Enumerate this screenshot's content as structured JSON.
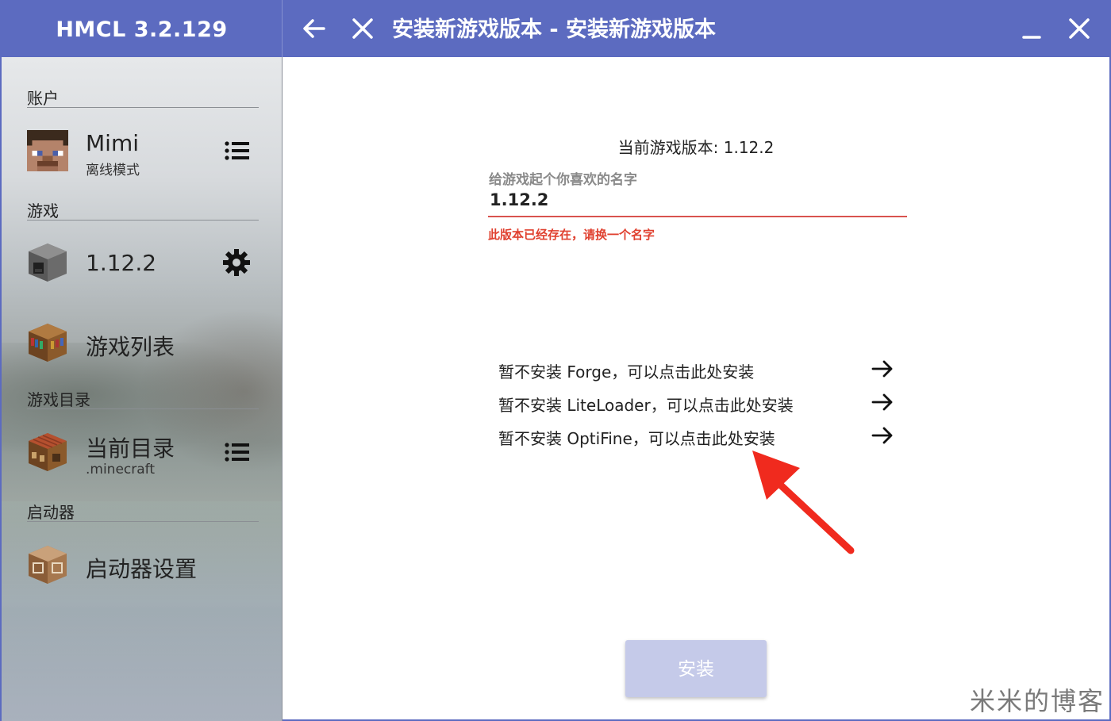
{
  "app": {
    "title": "HMCL 3.2.129"
  },
  "header": {
    "page_title": "安装新游戏版本 - 安装新游戏版本",
    "back_icon": "arrow-left-icon",
    "close_page_icon": "close-icon",
    "minimize_icon": "minimize-icon",
    "close_window_icon": "close-icon",
    "accent": "#5c6bc0"
  },
  "sidebar": {
    "sections": {
      "account": "账户",
      "game": "游戏",
      "game_dir": "游戏目录",
      "launcher": "启动器"
    },
    "account": {
      "name": "Mimi",
      "mode": "离线模式",
      "action_icon": "list-icon"
    },
    "version": {
      "label": "1.12.2",
      "action_icon": "gear-icon"
    },
    "game_list": {
      "label": "游戏列表"
    },
    "current_dir": {
      "label": "当前目录",
      "sub": ".minecraft",
      "action_icon": "list-icon"
    },
    "launcher_settings": {
      "label": "启动器设置"
    }
  },
  "main": {
    "current_version": "当前游戏版本: 1.12.2",
    "name_label": "给游戏起个你喜欢的名字",
    "name_value": "1.12.2",
    "error": "此版本已经存在，请换一个名字",
    "addons": [
      {
        "label": "暂不安装 Forge，可以点击此处安装",
        "icon": "arrow-right-icon"
      },
      {
        "label": "暂不安装 LiteLoader，可以点击此处安装",
        "icon": "arrow-right-icon"
      },
      {
        "label": "暂不安装 OptiFine，可以点击此处安装",
        "icon": "arrow-right-icon"
      }
    ],
    "install_button": "安装",
    "error_color": "#e0402f",
    "button_color": "#c5cae9"
  },
  "watermark": "米米的博客"
}
